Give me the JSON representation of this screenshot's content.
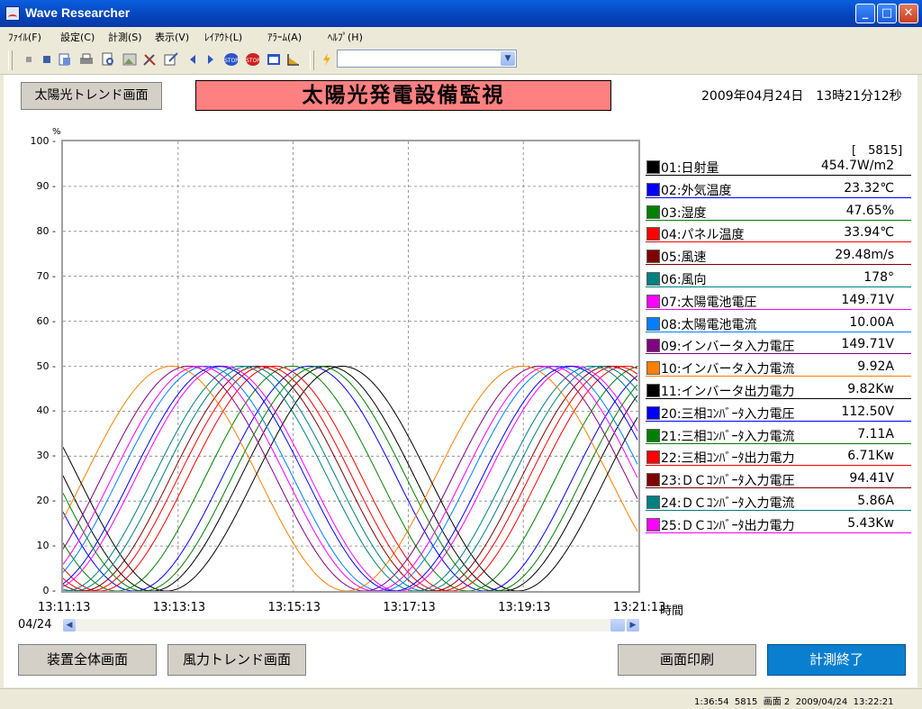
{
  "window": {
    "title": "Wave Researcher",
    "minimize_glyph": "_",
    "maximize_glyph": "□",
    "close_glyph": "✕"
  },
  "menu": [
    "ﾌｧｲﾙ(F)",
    "設定(C)",
    "計測(S)",
    "表示(V)",
    "ﾚｲｱｳﾄ(L)",
    "ｱﾗｰﾑ(A)",
    "ﾍﾙﾌﾟ(H)"
  ],
  "toolbar": {
    "icons": [
      "stop-square-icon",
      "stop-square-icon",
      "open-icon",
      "print-icon",
      "preview-icon",
      "image-icon",
      "tools-icon",
      "edit-icon",
      "prev-arrow-icon",
      "next-arrow-icon",
      "stop-badge-icon",
      "stop-badge-red-icon",
      "window-icon",
      "chart-icon",
      "flash-icon"
    ],
    "combo_value": ""
  },
  "header": {
    "trend_button": "太陽光トレンド画面",
    "banner_title": "太陽光発電設備監視",
    "datetime": "2009年04月24日　13時21分12秒"
  },
  "chart": {
    "y_unit": "%",
    "x_unit": "時間",
    "x_date": "04/24",
    "count_label": "[　5815]"
  },
  "chart_data": {
    "type": "line",
    "ylim": [
      0,
      100
    ],
    "y_ticks": [
      "100",
      "90",
      "80",
      "70",
      "60",
      "50",
      "40",
      "30",
      "20",
      "10",
      "0"
    ],
    "x_tick_labels": [
      "13:11:13",
      "13:13:13",
      "13:15:13",
      "13:17:13",
      "13:19:13",
      "13:21:13"
    ],
    "grid": true,
    "series_count": 16,
    "series": [
      {
        "color": "#000000",
        "peak_time": "13:15:49",
        "min": 0,
        "max": 50
      },
      {
        "color": "#0000ff",
        "peak_time": "13:15:30",
        "min": 0,
        "max": 50
      },
      {
        "color": "#008000",
        "peak_time": "13:15:12",
        "min": 0,
        "max": 50
      },
      {
        "color": "#ff0000",
        "peak_time": "13:14:54",
        "min": 0,
        "max": 50
      },
      {
        "color": "#800000",
        "peak_time": "13:14:36",
        "min": 0,
        "max": 50
      },
      {
        "color": "#008080",
        "peak_time": "13:14:18",
        "min": 0,
        "max": 50
      },
      {
        "color": "#ff00ff",
        "peak_time": "13:14:00",
        "min": 0,
        "max": 50
      },
      {
        "color": "#0080ff",
        "peak_time": "13:13:42",
        "min": 0,
        "max": 50
      },
      {
        "color": "#800080",
        "peak_time": "13:13:24",
        "min": 0,
        "max": 50
      },
      {
        "color": "#ff8000",
        "peak_time": "13:13:06",
        "min": 0,
        "max": 50
      },
      {
        "color": "#000000",
        "peak_time": "13:16:04",
        "min": 0,
        "max": 50
      },
      {
        "color": "#0000ff",
        "peak_time": "13:13:55",
        "min": 0,
        "max": 50
      },
      {
        "color": "#008000",
        "peak_time": "13:15:40",
        "min": 0,
        "max": 50
      },
      {
        "color": "#ff0000",
        "peak_time": "13:14:44",
        "min": 0,
        "max": 50
      },
      {
        "color": "#008080",
        "peak_time": "13:14:27",
        "min": 0,
        "max": 50
      },
      {
        "color": "#ff00ff",
        "peak_time": "13:13:35",
        "min": 0,
        "max": 50
      }
    ]
  },
  "legend": [
    {
      "label": "01:日射量",
      "value": "454.7W/m2",
      "color": "#000000"
    },
    {
      "label": "02:外気温度",
      "value": "23.32℃",
      "color": "#0000ff"
    },
    {
      "label": "03:湿度",
      "value": "47.65%",
      "color": "#008000"
    },
    {
      "label": "04:パネル温度",
      "value": "33.94℃",
      "color": "#ff0000"
    },
    {
      "label": "05:風速",
      "value": "29.48m/s",
      "color": "#800000"
    },
    {
      "label": "06:風向",
      "value": "178°",
      "color": "#008080"
    },
    {
      "label": "07:太陽電池電圧",
      "value": "149.71V",
      "color": "#ff00ff"
    },
    {
      "label": "08:太陽電池電流",
      "value": "10.00A",
      "color": "#0080ff"
    },
    {
      "label": "09:インバータ入力電圧",
      "value": "149.71V",
      "color": "#800080"
    },
    {
      "label": "10:インバータ入力電流",
      "value": "9.92A",
      "color": "#ff8000"
    },
    {
      "label": "11:インバータ出力電力",
      "value": "9.82Kw",
      "color": "#000000"
    },
    {
      "label": "20:三相ｺﾝﾊﾞｰﾀ入力電圧",
      "value": "112.50V",
      "color": "#0000ff"
    },
    {
      "label": "21:三相ｺﾝﾊﾞｰﾀ入力電流",
      "value": "7.11A",
      "color": "#008000"
    },
    {
      "label": "22:三相ｺﾝﾊﾞｰﾀ出力電力",
      "value": "6.71Kw",
      "color": "#ff0000"
    },
    {
      "label": "23:ＤＣｺﾝﾊﾞｰﾀ入力電圧",
      "value": "94.41V",
      "color": "#800000"
    },
    {
      "label": "24:ＤＣｺﾝﾊﾞｰﾀ入力電流",
      "value": "5.86A",
      "color": "#008080"
    },
    {
      "label": "25:ＤＣｺﾝﾊﾞｰﾀ出力電力",
      "value": "5.43Kw",
      "color": "#ff00ff"
    }
  ],
  "footer": {
    "device_button": "装置全体画面",
    "wind_button": "風力トレンド画面",
    "print_button": "画面印刷",
    "stop_button": "計測終了"
  },
  "statusbar": {
    "text": "1:36:54  5815  画面 2  2009/04/24  13:22:21"
  }
}
